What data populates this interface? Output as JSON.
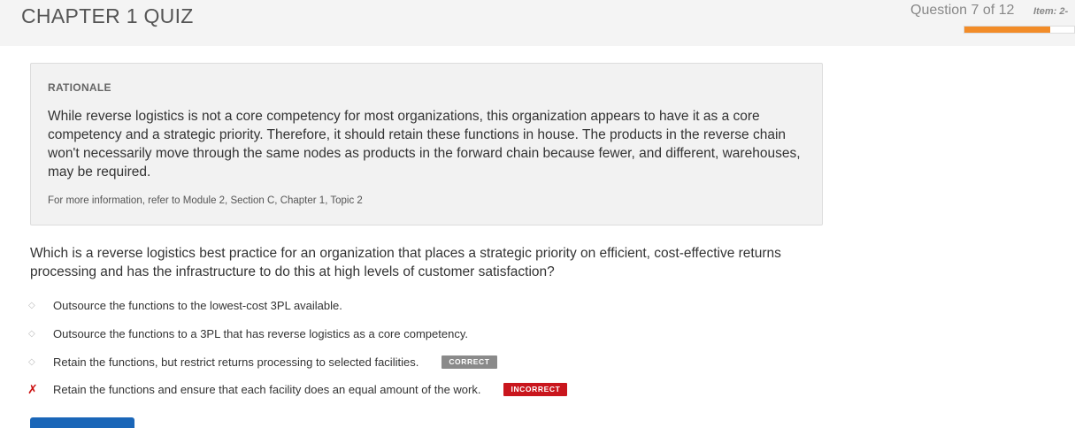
{
  "header": {
    "title": "CHAPTER 1 QUIZ",
    "question_count": "Question 7 of 12",
    "item_label": "Item: 2-",
    "progress_fraction": 0.78,
    "accent_color": "#f28c28"
  },
  "rationale": {
    "heading": "RATIONALE",
    "text": "While reverse logistics is not a core competency for most organizations, this organization appears to have it as a core competency and a strategic priority. Therefore, it should retain these functions in house. The products in the reverse chain won't necessarily move through the same nodes as products in the forward chain because fewer, and different, warehouses, may be required.",
    "reference": "For more information, refer to Module 2, Section C, Chapter 1, Topic 2"
  },
  "question": {
    "text": "Which is a reverse logistics best practice for an organization that places a strategic priority on efficient, cost-effective returns processing and has the infrastructure to do this at high levels of customer satisfaction?",
    "options": [
      {
        "label": "Outsource the functions to the lowest-cost 3PL available.",
        "marker": "◇",
        "badge": ""
      },
      {
        "label": "Outsource the functions to a 3PL that has reverse logistics as a core competency.",
        "marker": "◇",
        "badge": ""
      },
      {
        "label": "Retain the functions, but restrict returns processing to selected facilities.",
        "marker": "◇",
        "badge": "CORRECT"
      },
      {
        "label": "Retain the functions and ensure that each facility does an equal amount of the work.",
        "marker": "✗",
        "badge": "INCORRECT"
      }
    ]
  },
  "colors": {
    "correct_badge": "#8a8a8a",
    "incorrect_badge": "#c9161d",
    "wrong_marker": "#cc1111",
    "button": "#1a66b8"
  }
}
